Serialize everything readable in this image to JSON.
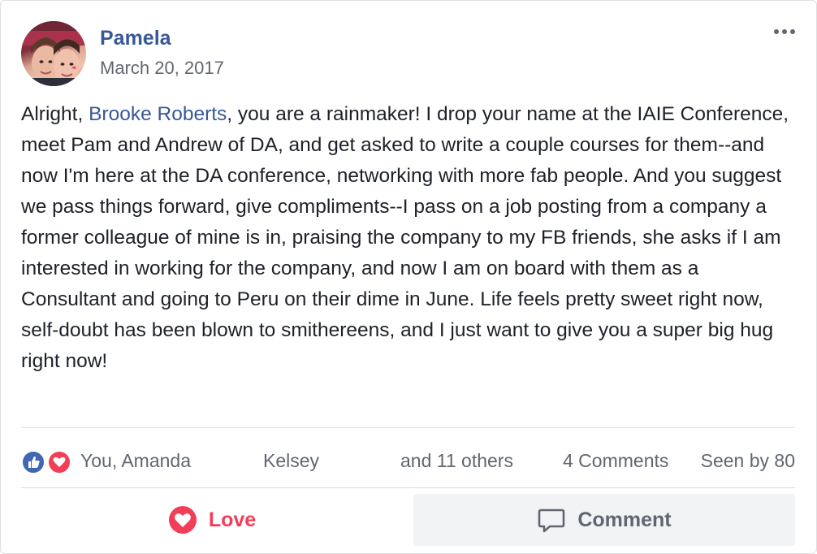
{
  "post": {
    "author": "Pamela",
    "timestamp": "March 20, 2017",
    "more_icon": "more-horizontal-icon",
    "body": {
      "before_mention": "Alright, ",
      "mention": "Brooke Roberts",
      "after_mention": ", you are a rainmaker! I drop your name at the IAIE Conference, meet Pam and Andrew of DA, and get asked to write a couple courses for them--and now I'm here at the DA conference, networking with more fab people. And you suggest we pass things forward, give compliments--I pass on a job posting from a company a former colleague of mine is in, praising the company to my FB friends, she asks if I am interested in working for the company, and now I am on board with them as a Consultant and going to Peru on their dime in June. Life feels pretty sweet right now, self-doubt has been blown to smithereens, and I just want to give you a super big hug right now!"
    }
  },
  "reactions": {
    "icons": [
      "like-icon",
      "love-icon"
    ],
    "reactors_1": "You, Amanda",
    "reactors_2": "Kelsey",
    "reactors_3": "and 11 others",
    "comments_count": "4 Comments",
    "seen_by": "Seen by 80"
  },
  "actions": {
    "love_label": "Love",
    "comment_label": "Comment"
  },
  "colors": {
    "link_blue": "#385898",
    "love_red": "#f33e58",
    "like_blue": "#4267b2",
    "muted_text": "#616770"
  }
}
